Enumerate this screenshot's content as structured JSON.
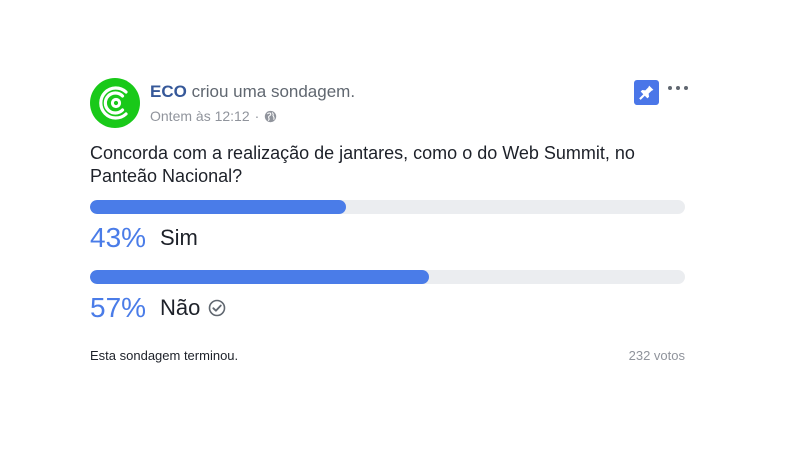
{
  "post": {
    "author": "ECO",
    "action": "criou uma sondagem.",
    "timestamp": "Ontem às 12:12",
    "separator": "·",
    "privacy_icon": "globe-icon",
    "pin_icon": "pin-icon",
    "more_icon": "more-options-icon"
  },
  "poll": {
    "question": "Concorda com a realização de jantares, como o do Web Summit, no Panteão Nacional?",
    "options": [
      {
        "percent_label": "43%",
        "label": "Sim",
        "fraction": 0.43,
        "selected": false
      },
      {
        "percent_label": "57%",
        "label": "Não",
        "fraction": 0.57,
        "selected": true
      }
    ],
    "status": "Esta sondagem terminou.",
    "votes": "232 votos"
  },
  "colors": {
    "accent": "#4a7ce8",
    "avatar_bg": "#19c919",
    "author_link": "#365899",
    "muted": "#90949c"
  }
}
